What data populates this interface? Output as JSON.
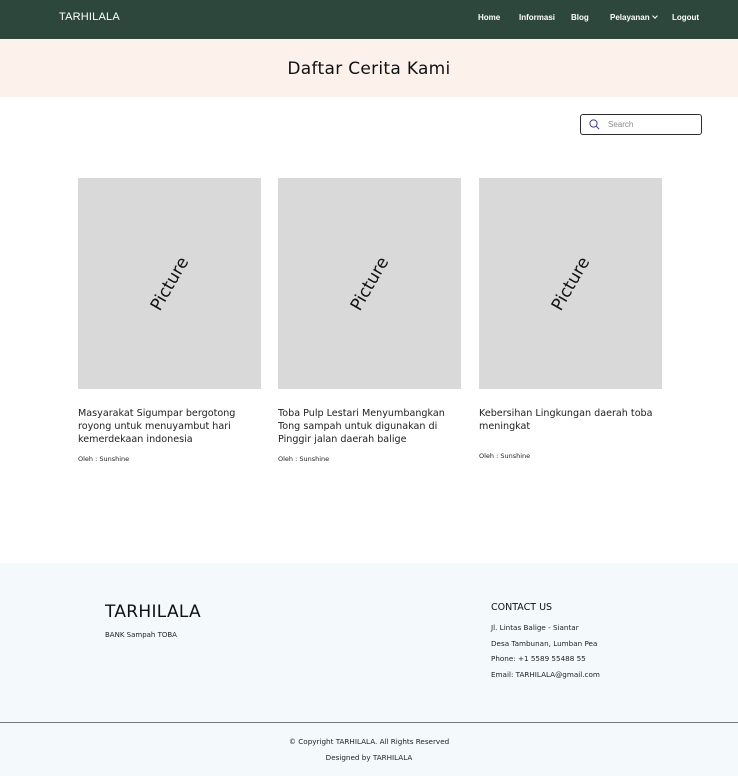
{
  "navbar": {
    "brand": "TARHILALA",
    "items": [
      {
        "label": "Home"
      },
      {
        "label": "Informasi"
      },
      {
        "label": "Blog"
      },
      {
        "label": "Pelayanan"
      },
      {
        "label": "Logout"
      }
    ],
    "background": "#2e473d"
  },
  "hero": {
    "title": "Daftar Cerita Kami",
    "background": "#fdf1ec"
  },
  "search": {
    "placeholder": "Search",
    "value": ""
  },
  "cards": [
    {
      "picture_label": "Picture",
      "title": "Masyarakat Sigumpar bergotong royong untuk menuyambut hari kemerdekaan indonesia",
      "author": "Oleh : Sunshine"
    },
    {
      "picture_label": "Picture",
      "title": "Toba Pulp Lestari Menyumbangkan Tong sampah untuk digunakan di Pinggir jalan daerah balige",
      "author": "Oleh : Sunshine"
    },
    {
      "picture_label": "Picture",
      "title": "Kebersihan Lingkungan daerah toba meningkat",
      "author": "Oleh : Sunshine"
    }
  ],
  "footer": {
    "brand": "TARHILALA",
    "subtitle": "BANK Sampah TOBA",
    "contact_title": "CONTACT US",
    "contact_lines": [
      "Jl. Lintas Balige - Siantar",
      "Desa Tambunan, Lumban Pea",
      "Phone: +1 5589 55488 55",
      "Email: TARHILALA@gmail.com"
    ],
    "copyright": "© Copyright TARHILALA. All Rights Reserved",
    "designed_by": "Designed by TARHILALA",
    "background": "#f4f9fc"
  }
}
